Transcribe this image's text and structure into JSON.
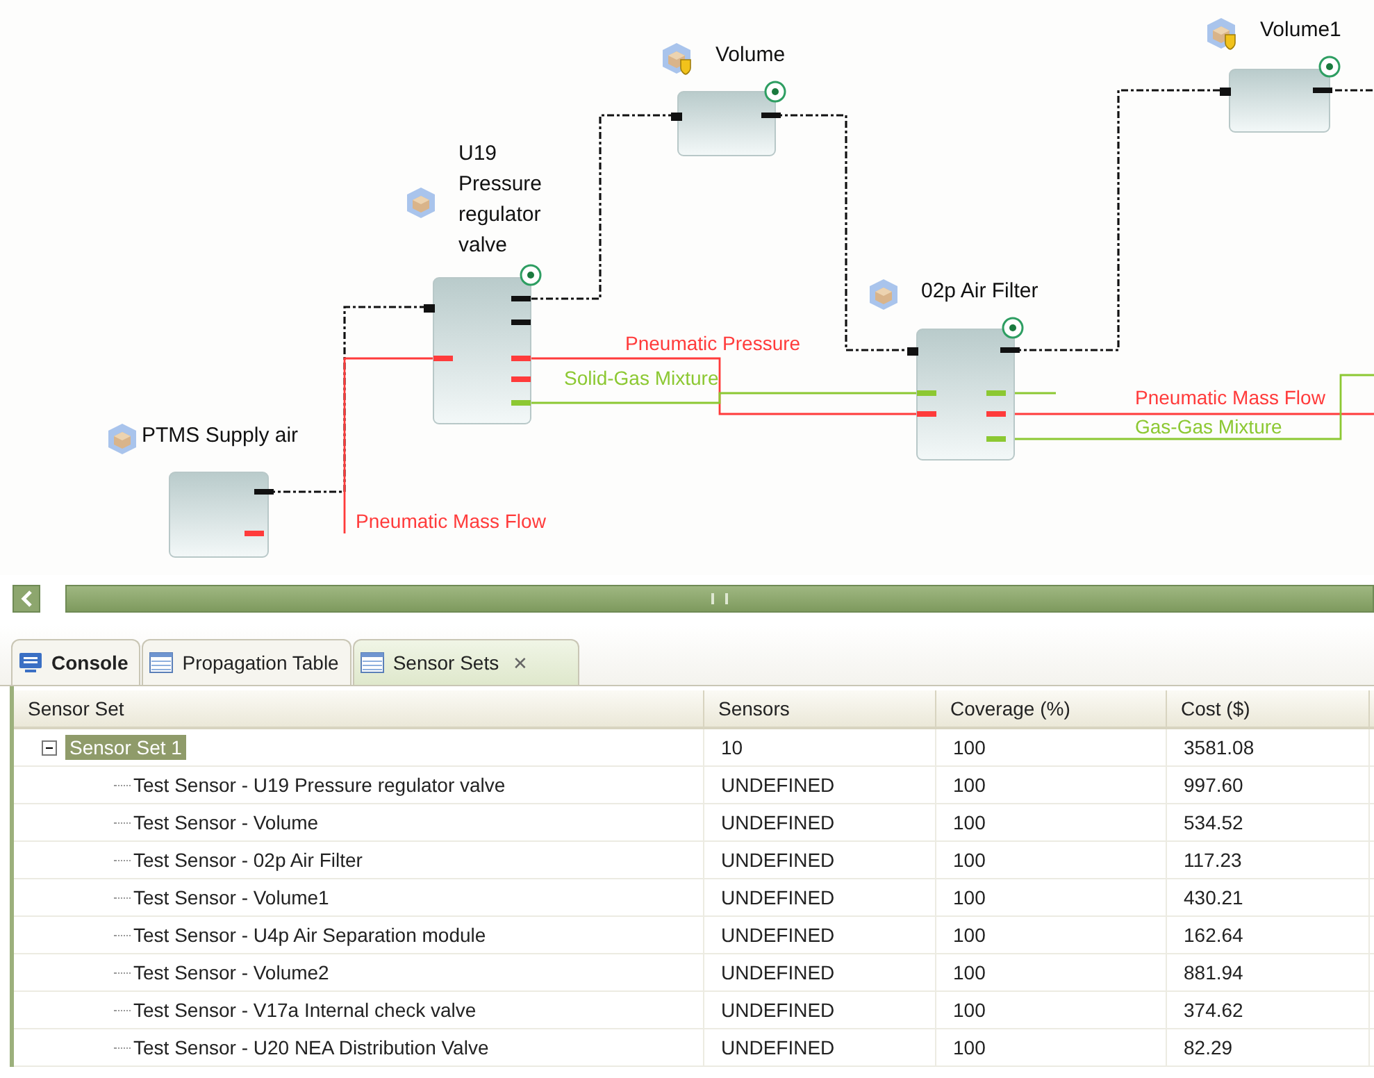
{
  "diagram": {
    "components": [
      {
        "name": "PTMS Supply air",
        "badge": false,
        "sensor": false
      },
      {
        "name": "U19 Pressure regulator valve",
        "badge": false,
        "sensor": true
      },
      {
        "name": "Volume",
        "badge": true,
        "sensor": true
      },
      {
        "name": "02p Air Filter",
        "badge": false,
        "sensor": true
      },
      {
        "name": "Volume1",
        "badge": true,
        "sensor": true
      }
    ],
    "flow_labels": [
      {
        "text": "Pneumatic Mass Flow",
        "kind": "pneumatic"
      },
      {
        "text": "Pneumatic Pressure",
        "kind": "pneumatic"
      },
      {
        "text": "Solid-Gas Mixture",
        "kind": "mixture"
      },
      {
        "text": "Pneumatic Mass Flow",
        "kind": "pneumatic"
      },
      {
        "text": "Gas-Gas Mixture",
        "kind": "mixture"
      }
    ]
  },
  "tabs": [
    {
      "label": "Console",
      "selected": false,
      "closable": false
    },
    {
      "label": "Propagation Table",
      "selected": false,
      "closable": false
    },
    {
      "label": "Sensor Sets",
      "selected": true,
      "closable": true,
      "close": "✕"
    }
  ],
  "table": {
    "columns": [
      "Sensor Set",
      "Sensors",
      "Coverage (%)",
      "Cost ($)"
    ],
    "rows": [
      {
        "cells": [
          "Sensor Set 1",
          "10",
          "100",
          "3581.08"
        ],
        "selected": true,
        "expanded": true,
        "children": [
          {
            "cells": [
              "Test Sensor - U19 Pressure regulator valve",
              "UNDEFINED",
              "100",
              "997.60"
            ],
            "selected": false
          },
          {
            "cells": [
              "Test Sensor - Volume",
              "UNDEFINED",
              "100",
              "534.52"
            ],
            "selected": false
          },
          {
            "cells": [
              "Test Sensor - 02p Air Filter",
              "UNDEFINED",
              "100",
              "117.23"
            ],
            "selected": false
          },
          {
            "cells": [
              "Test Sensor - Volume1",
              "UNDEFINED",
              "100",
              "430.21"
            ],
            "selected": false
          },
          {
            "cells": [
              "Test Sensor - U4p Air Separation module",
              "UNDEFINED",
              "100",
              "162.64"
            ],
            "selected": false
          },
          {
            "cells": [
              "Test Sensor - Volume2",
              "UNDEFINED",
              "100",
              "881.94"
            ],
            "selected": false
          },
          {
            "cells": [
              "Test Sensor - V17a Internal check valve",
              "UNDEFINED",
              "100",
              "374.62"
            ],
            "selected": false
          },
          {
            "cells": [
              "Test Sensor - U20 NEA Distribution Valve",
              "UNDEFINED",
              "100",
              "82.29"
            ],
            "selected": false
          }
        ]
      }
    ]
  }
}
